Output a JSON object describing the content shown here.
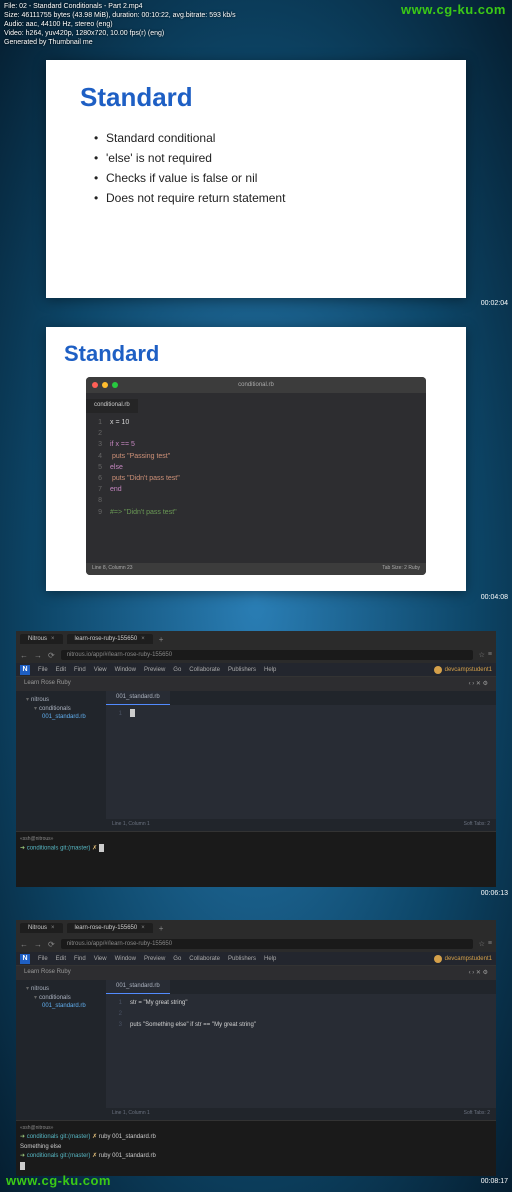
{
  "watermark": "www.cg-ku.com",
  "metadata": {
    "file": "File: 02 - Standard Conditionals - Part 2.mp4",
    "size": "Size: 46111755 bytes (43.98 MiB), duration: 00:10:22, avg.bitrate: 593 kb/s",
    "audio": "Audio: aac, 44100 Hz, stereo (eng)",
    "video": "Video: h264, yuv420p, 1280x720, 10.00 fps(r) (eng)",
    "gen": "Generated by Thumbnail me"
  },
  "timestamps": {
    "t1": "00:02:04",
    "t2": "00:04:08",
    "t3": "00:06:13",
    "t4": "00:08:17"
  },
  "slide1": {
    "title": "Standard",
    "bullets": [
      "Standard conditional",
      "'else' is not required",
      "Checks if value is false or nil",
      "Does not require return statement"
    ]
  },
  "slide2": {
    "title": "Standard",
    "filename": "conditional.rb",
    "code": [
      {
        "n": "1",
        "txt": "x = 10"
      },
      {
        "n": "2",
        "txt": ""
      },
      {
        "n": "3",
        "txt": "if x == 5"
      },
      {
        "n": "4",
        "txt": "  puts \"Passing test\""
      },
      {
        "n": "5",
        "txt": "else"
      },
      {
        "n": "6",
        "txt": "  puts \"Didn't pass test\""
      },
      {
        "n": "7",
        "txt": "end"
      },
      {
        "n": "8",
        "txt": ""
      },
      {
        "n": "9",
        "txt": "#=> \"Didn't pass test\""
      }
    ],
    "status_left": "Line 8, Column 23",
    "status_right": "Tab Size: 2    Ruby"
  },
  "browser": {
    "tab1": "Nitrous",
    "tab2": "learn-rose-ruby-155650",
    "url": "nitrous.io/app/#/learn-rose-ruby-155650",
    "logo": "N",
    "menu": [
      "File",
      "Edit",
      "Find",
      "View",
      "Window",
      "Preview",
      "Go",
      "Collaborate",
      "Publishers",
      "Help"
    ],
    "user": "devcampstudent1",
    "project": "Learn Rose Ruby",
    "tree": {
      "root": "nitrous",
      "folder": "conditionals",
      "file": "001_standard.rb"
    },
    "code_tab": "001_standard.rb",
    "status_left": "Line 1, Column 1",
    "status_right": "Soft Tabs: 2",
    "term_tab": "«ssh@nitrous»",
    "prompt_path": "conditionals",
    "prompt_branch": "git:(master)",
    "prompt_sym": "✗"
  },
  "browser2_code": {
    "l1": "str = \"My great string\"",
    "l3": "puts \"Something else\" if str == \"My great string\""
  },
  "term2": {
    "cmd": "ruby 001_standard.rb",
    "out": "Something else"
  }
}
